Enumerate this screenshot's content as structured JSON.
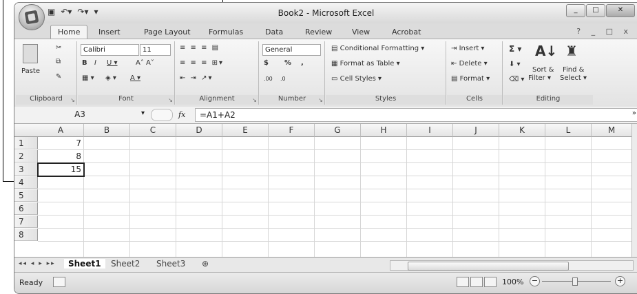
{
  "window": {
    "title": "Book2 - Microsoft Excel"
  },
  "tabs": [
    "Home",
    "Insert",
    "Page Layout",
    "Formulas",
    "Data",
    "Review",
    "View",
    "Acrobat"
  ],
  "ribbon": {
    "clipboard": {
      "label": "Clipboard",
      "paste": "Paste"
    },
    "font": {
      "label": "Font",
      "name": "Calibri",
      "size": "11"
    },
    "alignment": {
      "label": "Alignment"
    },
    "number": {
      "label": "Number",
      "format": "General",
      "currency": "$",
      "percent": "%",
      "comma": ",",
      "inc_decimal": ".00",
      "dec_decimal": ".0"
    },
    "styles": {
      "label": "Styles",
      "conditional": "Conditional Formatting",
      "format_table": "Format as Table",
      "cell_styles": "Cell Styles"
    },
    "cells": {
      "label": "Cells",
      "insert": "Insert",
      "delete": "Delete",
      "format": "Format"
    },
    "editing": {
      "label": "Editing",
      "sort": "Sort &",
      "filter": "Filter",
      "find": "Find &",
      "select": "Select",
      "sigma": "Σ"
    }
  },
  "formula_bar": {
    "name_box": "A3",
    "fx": "fx",
    "formula": "=A1+A2"
  },
  "columns": [
    "A",
    "B",
    "C",
    "D",
    "E",
    "F",
    "G",
    "H",
    "I",
    "J",
    "K",
    "L",
    "M"
  ],
  "rows": [
    "1",
    "2",
    "3",
    "4",
    "5",
    "6",
    "7",
    "8"
  ],
  "cells": {
    "A1": "7",
    "A2": "8",
    "A3": "15"
  },
  "sheets": [
    "Sheet1",
    "Sheet2",
    "Sheet3"
  ],
  "status": {
    "ready": "Ready",
    "zoom": "100%"
  }
}
